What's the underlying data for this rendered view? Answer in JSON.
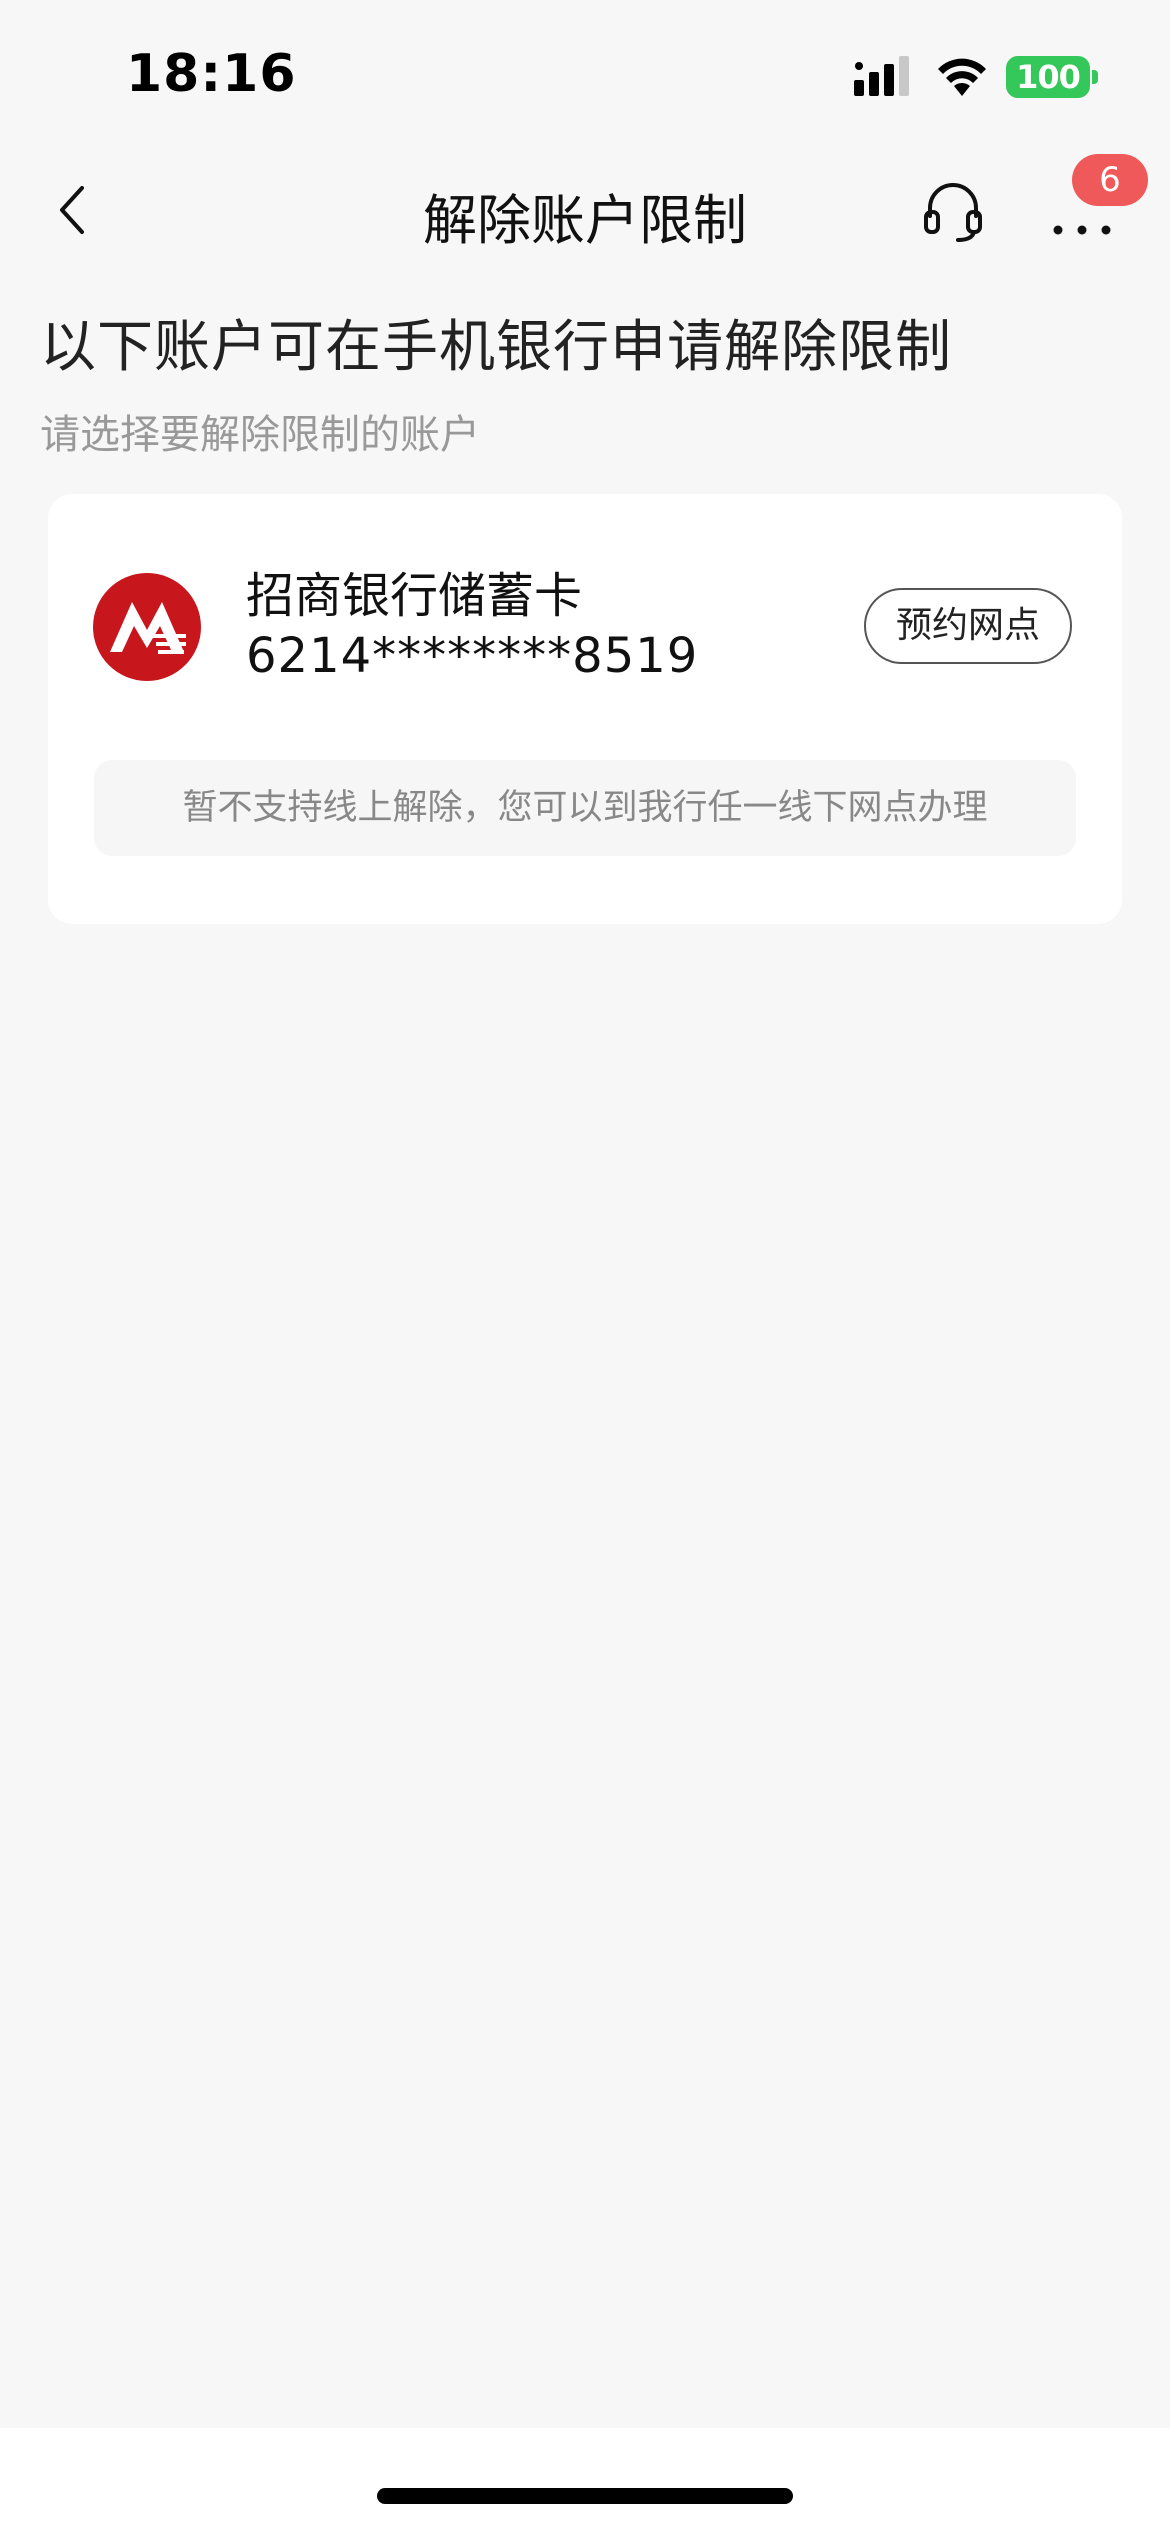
{
  "status_bar": {
    "time": "18:16",
    "battery": "100"
  },
  "nav": {
    "title": "解除账户限制",
    "badge_count": "6"
  },
  "page": {
    "heading": "以下账户可在手机银行申请解除限制",
    "subheading": "请选择要解除限制的账户"
  },
  "account": {
    "bank_name": "招商银行储蓄卡",
    "card_number": "6214********8519",
    "action_label": "预约网点",
    "notice": "暂不支持线上解除，您可以到我行任一线下网点办理"
  },
  "colors": {
    "background": "#f7f7f7",
    "badge": "#f0595a",
    "bank_logo_red": "#c8161d",
    "battery_green": "#34c759"
  }
}
